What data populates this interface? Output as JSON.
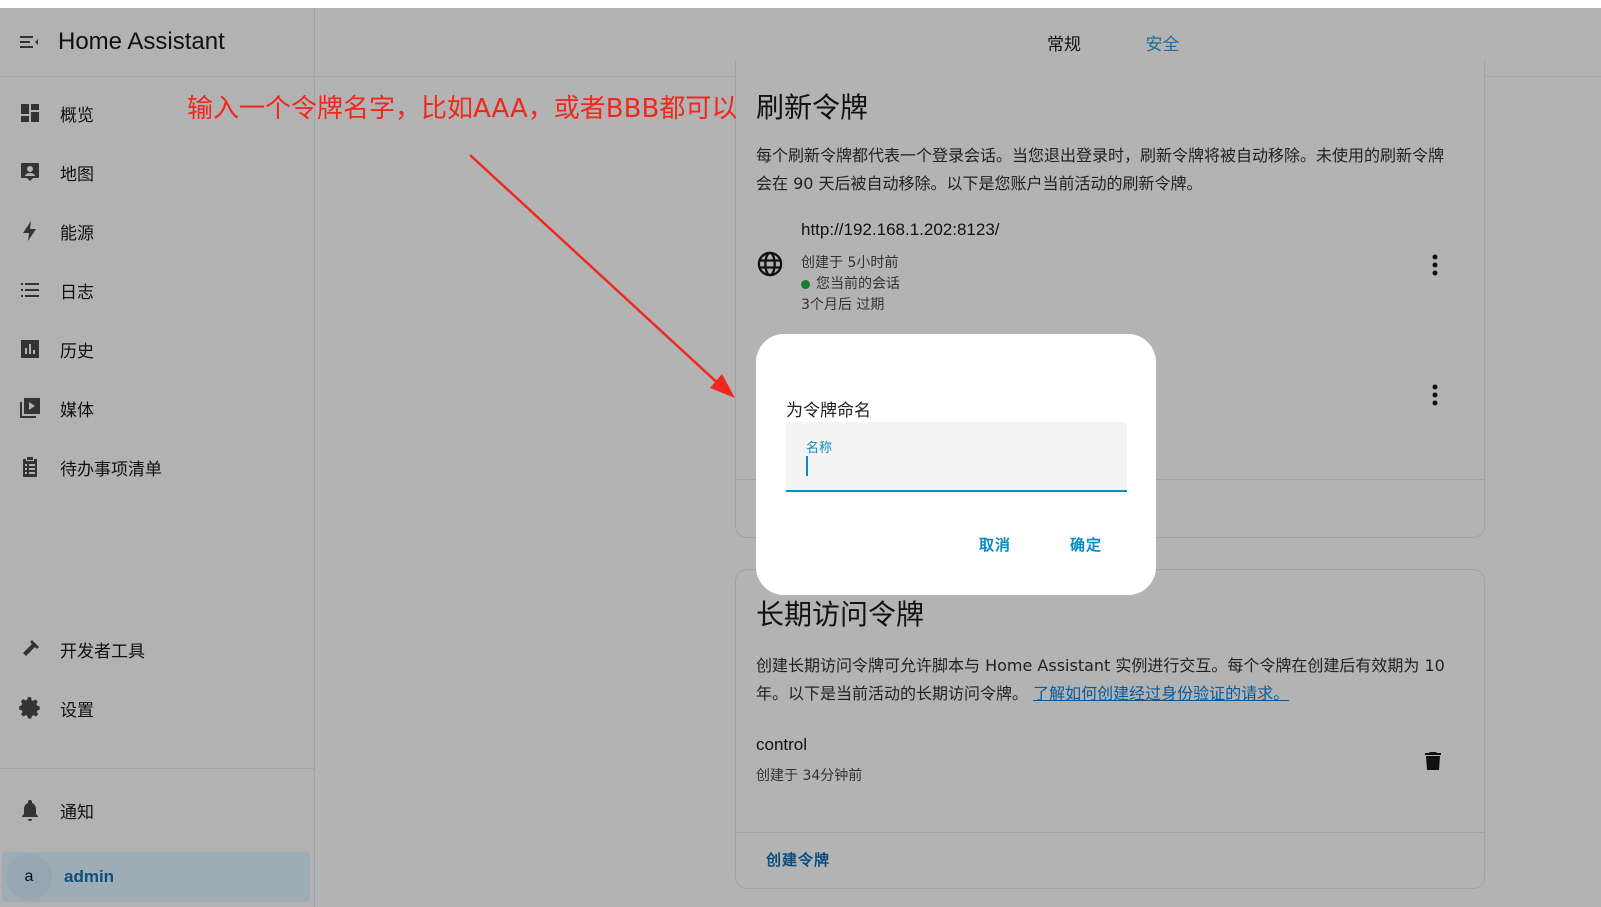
{
  "app": {
    "title": "Home Assistant"
  },
  "sidebar": {
    "items": [
      {
        "label": "概览",
        "icon": "dashboard-icon"
      },
      {
        "label": "地图",
        "icon": "map-icon"
      },
      {
        "label": "能源",
        "icon": "lightning-icon"
      },
      {
        "label": "日志",
        "icon": "logbook-icon"
      },
      {
        "label": "历史",
        "icon": "history-chart-icon"
      },
      {
        "label": "媒体",
        "icon": "media-icon"
      },
      {
        "label": "待办事项清单",
        "icon": "todo-list-icon"
      }
    ],
    "developer_tools": "开发者工具",
    "settings": "设置",
    "notifications": "通知",
    "user": {
      "avatar_letter": "a",
      "name": "admin"
    }
  },
  "tabs": {
    "general": "常规",
    "security": "安全"
  },
  "refresh_tokens": {
    "title": "刷新令牌",
    "description": "每个刷新令牌都代表一个登录会话。当您退出登录时，刷新令牌将被自动移除。未使用的刷新令牌会在 90 天后被自动移除。以下是您账户当前活动的刷新令牌。",
    "session": {
      "url": "http://192.168.1.202:8123/",
      "created": "创建于 5小时前",
      "current": "您当前的会话",
      "expires": "3个月后 过期"
    }
  },
  "long_lived_tokens": {
    "title": "长期访问令牌",
    "description": "创建长期访问令牌可允许脚本与 Home Assistant 实例进行交互。每个令牌在创建后有效期为 10 年。以下是当前活动的长期访问令牌。",
    "link_text": "了解如何创建经过身份验证的请求。",
    "token": {
      "name": "control",
      "created": "创建于 34分钟前"
    },
    "create_button": "创建令牌"
  },
  "dialog": {
    "title": "为令牌命名",
    "field_label": "名称",
    "field_value": "",
    "cancel": "取消",
    "ok": "确定"
  },
  "annotation": {
    "text": "输入一个令牌名字，比如AAA，或者BBB都可以",
    "color": "#f0281e"
  }
}
